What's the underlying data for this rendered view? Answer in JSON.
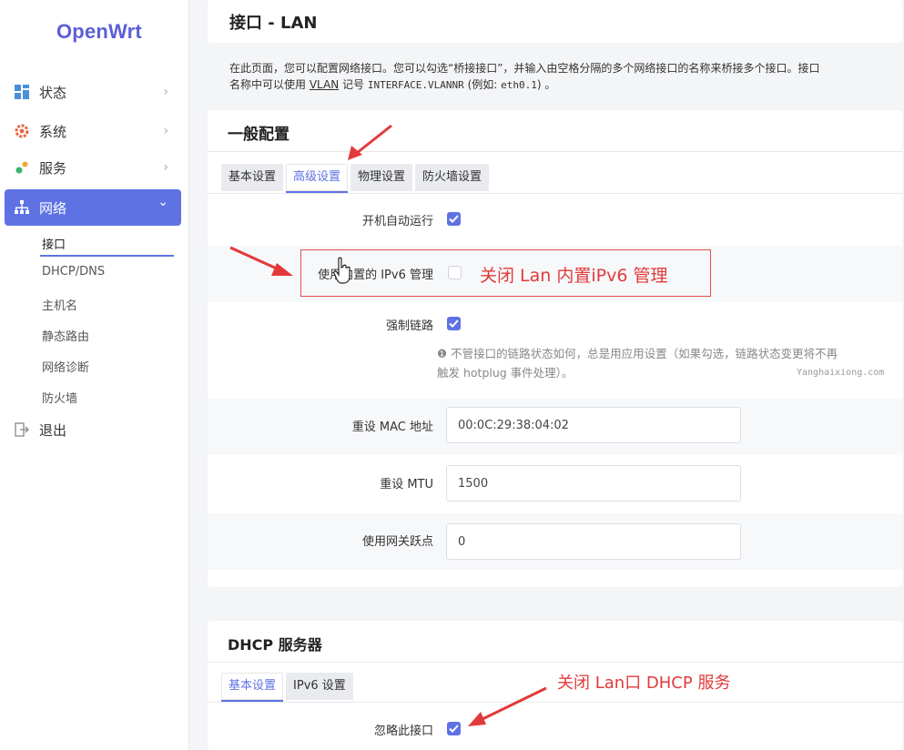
{
  "sidebar": {
    "logo": "OpenWrt",
    "items": [
      {
        "label": "状态",
        "chevron": "›"
      },
      {
        "label": "系统",
        "chevron": "›"
      },
      {
        "label": "服务",
        "chevron": "›"
      },
      {
        "label": "网络",
        "chevron": "⌄"
      }
    ],
    "subitems": [
      "接口",
      "DHCP/DNS",
      "主机名",
      "静态路由",
      "网络诊断",
      "防火墙"
    ],
    "logout": "退出"
  },
  "header": {
    "title": "接口 - LAN"
  },
  "description": {
    "line1": "在此页面，您可以配置网络接口。您可以勾选“桥接接口”，并输入由空格分隔的多个网络接口的名称来桥接多个接口。接口",
    "line2_a": "名称中可以使用 ",
    "vlan": "VLAN",
    "line2_b": " 记号 ",
    "code1": "INTERFACE.VLANNR",
    "line2_c": " (例如: ",
    "code2": "eth0.1",
    "line2_d": ") 。"
  },
  "general": {
    "title": "一般配置",
    "tabs": [
      "基本设置",
      "高级设置",
      "物理设置",
      "防火墙设置"
    ],
    "active_tab": 1,
    "fields": {
      "autostart_label": "开机自动运行",
      "autostart_checked": true,
      "ipv6_label": "使用内置的 IPv6 管理",
      "ipv6_checked": false,
      "force_link_label": "强制链路",
      "force_link_checked": true,
      "force_link_help_1": "❶ 不管接口的链路状态如何，总是用应用设置（如果勾选，链路状态变更将不再",
      "force_link_help_2": "触发 hotplug 事件处理）。",
      "mac_label": "重设 MAC 地址",
      "mac_value": "00:0C:29:38:04:02",
      "mtu_label": "重设 MTU",
      "mtu_value": "1500",
      "metric_label": "使用网关跃点",
      "metric_value": "0"
    },
    "watermark": "Yanghaixiong.com"
  },
  "dhcp": {
    "title": "DHCP 服务器",
    "tabs": [
      "基本设置",
      "IPv6 设置"
    ],
    "active_tab": 0,
    "ignore_label": "忽略此接口",
    "ignore_checked": true
  },
  "annotations": {
    "ipv6_note": "关闭 Lan 内置iPv6 管理",
    "dhcp_note": "关闭 Lan口 DHCP 服务"
  },
  "colors": {
    "accent": "#5e72e4",
    "annotation": "#e23a3a"
  }
}
